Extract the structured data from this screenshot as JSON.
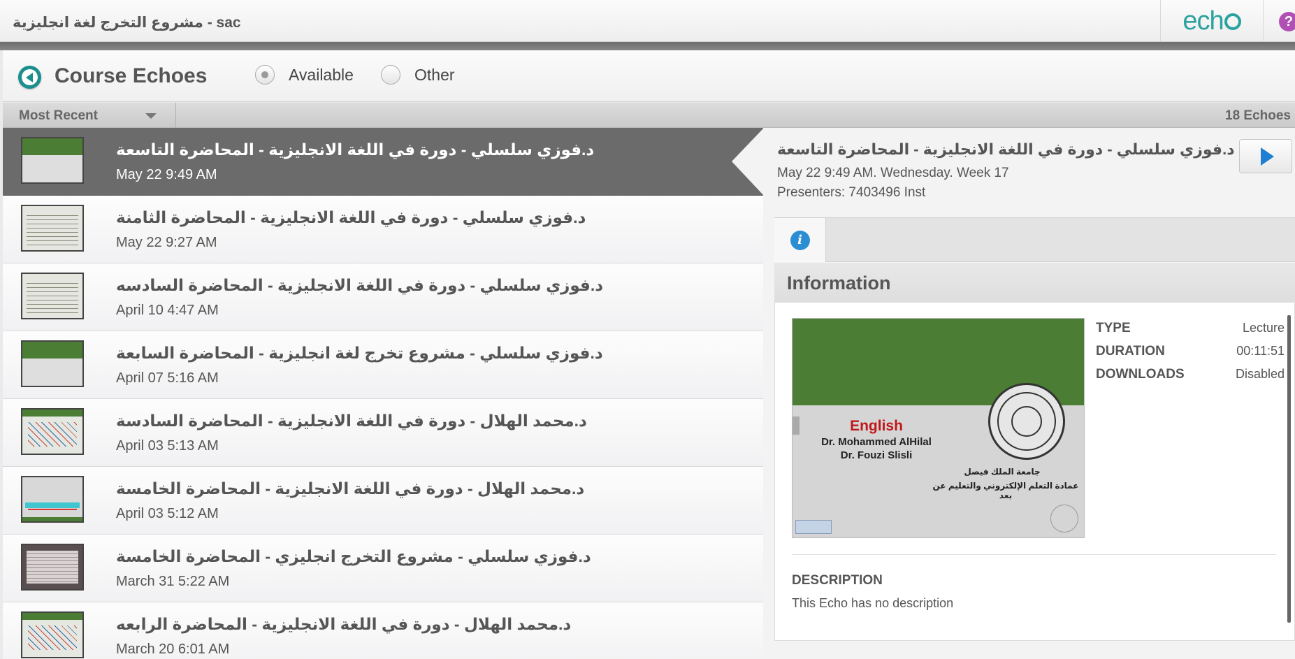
{
  "topbar": {
    "course_title": "مشروع التخرج لغة انجليزية - sac",
    "logo_text": "ech",
    "help_label": "?"
  },
  "header": {
    "title": "Course Echoes",
    "filters": [
      {
        "label": "Available",
        "selected": true
      },
      {
        "label": "Other",
        "selected": false
      }
    ]
  },
  "sortbar": {
    "sort_label": "Most Recent",
    "count_label": "18 Echoes"
  },
  "echoes": [
    {
      "title": "د.فوزي سلسلي - دورة في اللغة الانجليزية - المحاضرة التاسعة",
      "date": "May 22 9:49 AM",
      "thumb": "slide-title",
      "selected": true
    },
    {
      "title": "د.فوزي سلسلي - دورة في اللغة الانجليزية - المحاضرة الثامنة",
      "date": "May 22 9:27 AM",
      "thumb": "slide-text"
    },
    {
      "title": "د.فوزي سلسلي - دورة في اللغة الانجليزية - المحاضرة السادسه",
      "date": "April 10 4:47 AM",
      "thumb": "slide-text"
    },
    {
      "title": "د.فوزي سلسلي - مشروع تخرج لغة انجليزية - المحاضرة السابعة",
      "date": "April 07 5:16 AM",
      "thumb": "slide-title"
    },
    {
      "title": "د.محمد الهلال - دورة في اللغة الانجليزية - المحاضرة السادسة",
      "date": "April 03 5:13 AM",
      "thumb": "slide-mixed"
    },
    {
      "title": "د.محمد الهلال - دورة في اللغة الانجليزية - المحاضرة الخامسة",
      "date": "April 03 5:12 AM",
      "thumb": "slide-chalk"
    },
    {
      "title": "د.فوزي سلسلي - مشروع التخرج انجليزي - المحاضرة الخامسة",
      "date": "March 31 5:22 AM",
      "thumb": "slide-dark"
    },
    {
      "title": "د.محمد الهلال - دورة في اللغة الانجليزية - المحاضرة الرابعه",
      "date": "March 20 6:01 AM",
      "thumb": "slide-mixed"
    }
  ],
  "detail": {
    "title": "د.فوزي سلسلي - دورة في اللغة الانجليزية - المحاضرة التاسعة",
    "meta": "May 22 9:49 AM. Wednesday. Week 17",
    "presenters": "Presenters: 7403496 Inst",
    "info_heading": "Information",
    "preview": {
      "heading": "English",
      "name1": "Dr. Mohammed AlHilal",
      "name2": "Dr. Fouzi Slisli",
      "arabic1": "جامعة الملك فيصل",
      "arabic2": "عمادة التعلم الإلكتروني والتعليم عن بعد"
    },
    "fields": [
      {
        "key": "TYPE",
        "value": "Lecture"
      },
      {
        "key": "DURATION",
        "value": "00:11:51"
      },
      {
        "key": "DOWNLOADS",
        "value": "Disabled"
      }
    ],
    "description_heading": "DESCRIPTION",
    "description": "This Echo has no description"
  },
  "colors": {
    "accent_teal": "#1b8e8e",
    "selected_row": "#6b6b6b",
    "play_blue": "#1f7fd0",
    "slide_green": "#4b7d34"
  }
}
